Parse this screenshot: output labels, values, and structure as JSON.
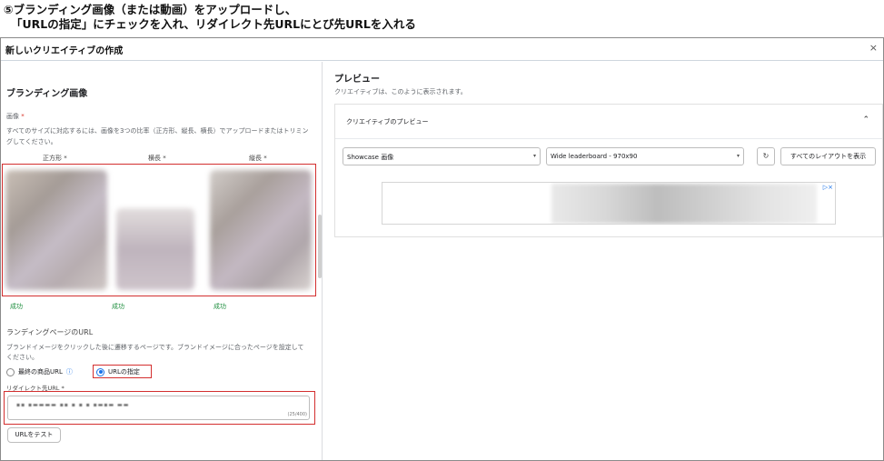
{
  "instruction": {
    "line1": "⑤ブランディング画像（または動画）をアップロードし、",
    "line2": "「URLの指定」にチェックを入れ、リダイレクト先URLにとび先URLを入れる"
  },
  "dialog": {
    "title": "新しいクリエイティブの作成",
    "close": "×"
  },
  "left": {
    "section_title": "ブランディング画像",
    "image_label": "画像",
    "required_mark": "*",
    "image_description": "すべてのサイズに対応するには、画像を3つの比率（正方形、縦長、横長）でアップロードまたはトリミングしてください。",
    "columns": [
      "正方形 *",
      "横長 *",
      "縦長 *"
    ],
    "status": [
      "成功",
      "成功",
      "成功"
    ],
    "landing_title": "ランディングページのURL",
    "landing_description": "ブランドイメージをクリックした後に遷移するページです。ブランドイメージに合ったページを設定してください。",
    "radio_final_url": "最終の商品URL",
    "radio_info_icon": "ⓘ",
    "radio_specify_url": "URLの指定",
    "redirect_label": "リダイレクト先URL *",
    "redirect_value": "▪▪ ▪▬▬▬▬ ▪▪ ▪ ▪ ▪ ▪▬▪▬ ▬▬",
    "redirect_counter": "(25/400)",
    "test_button": "URLをテスト"
  },
  "right": {
    "preview_title": "プレビュー",
    "preview_subtitle": "クリエイティブは、このように表示されます。",
    "card_title": "クリエイティブのプレビュー",
    "collapse_icon": "⌃",
    "select_format": "Showcase 画像",
    "select_layout": "Wide leaderboard - 970x90",
    "select_arrow": "▾",
    "refresh_icon": "↻",
    "all_layouts_button": "すべてのレイアウトを表示",
    "ad_choices": "▷×"
  }
}
